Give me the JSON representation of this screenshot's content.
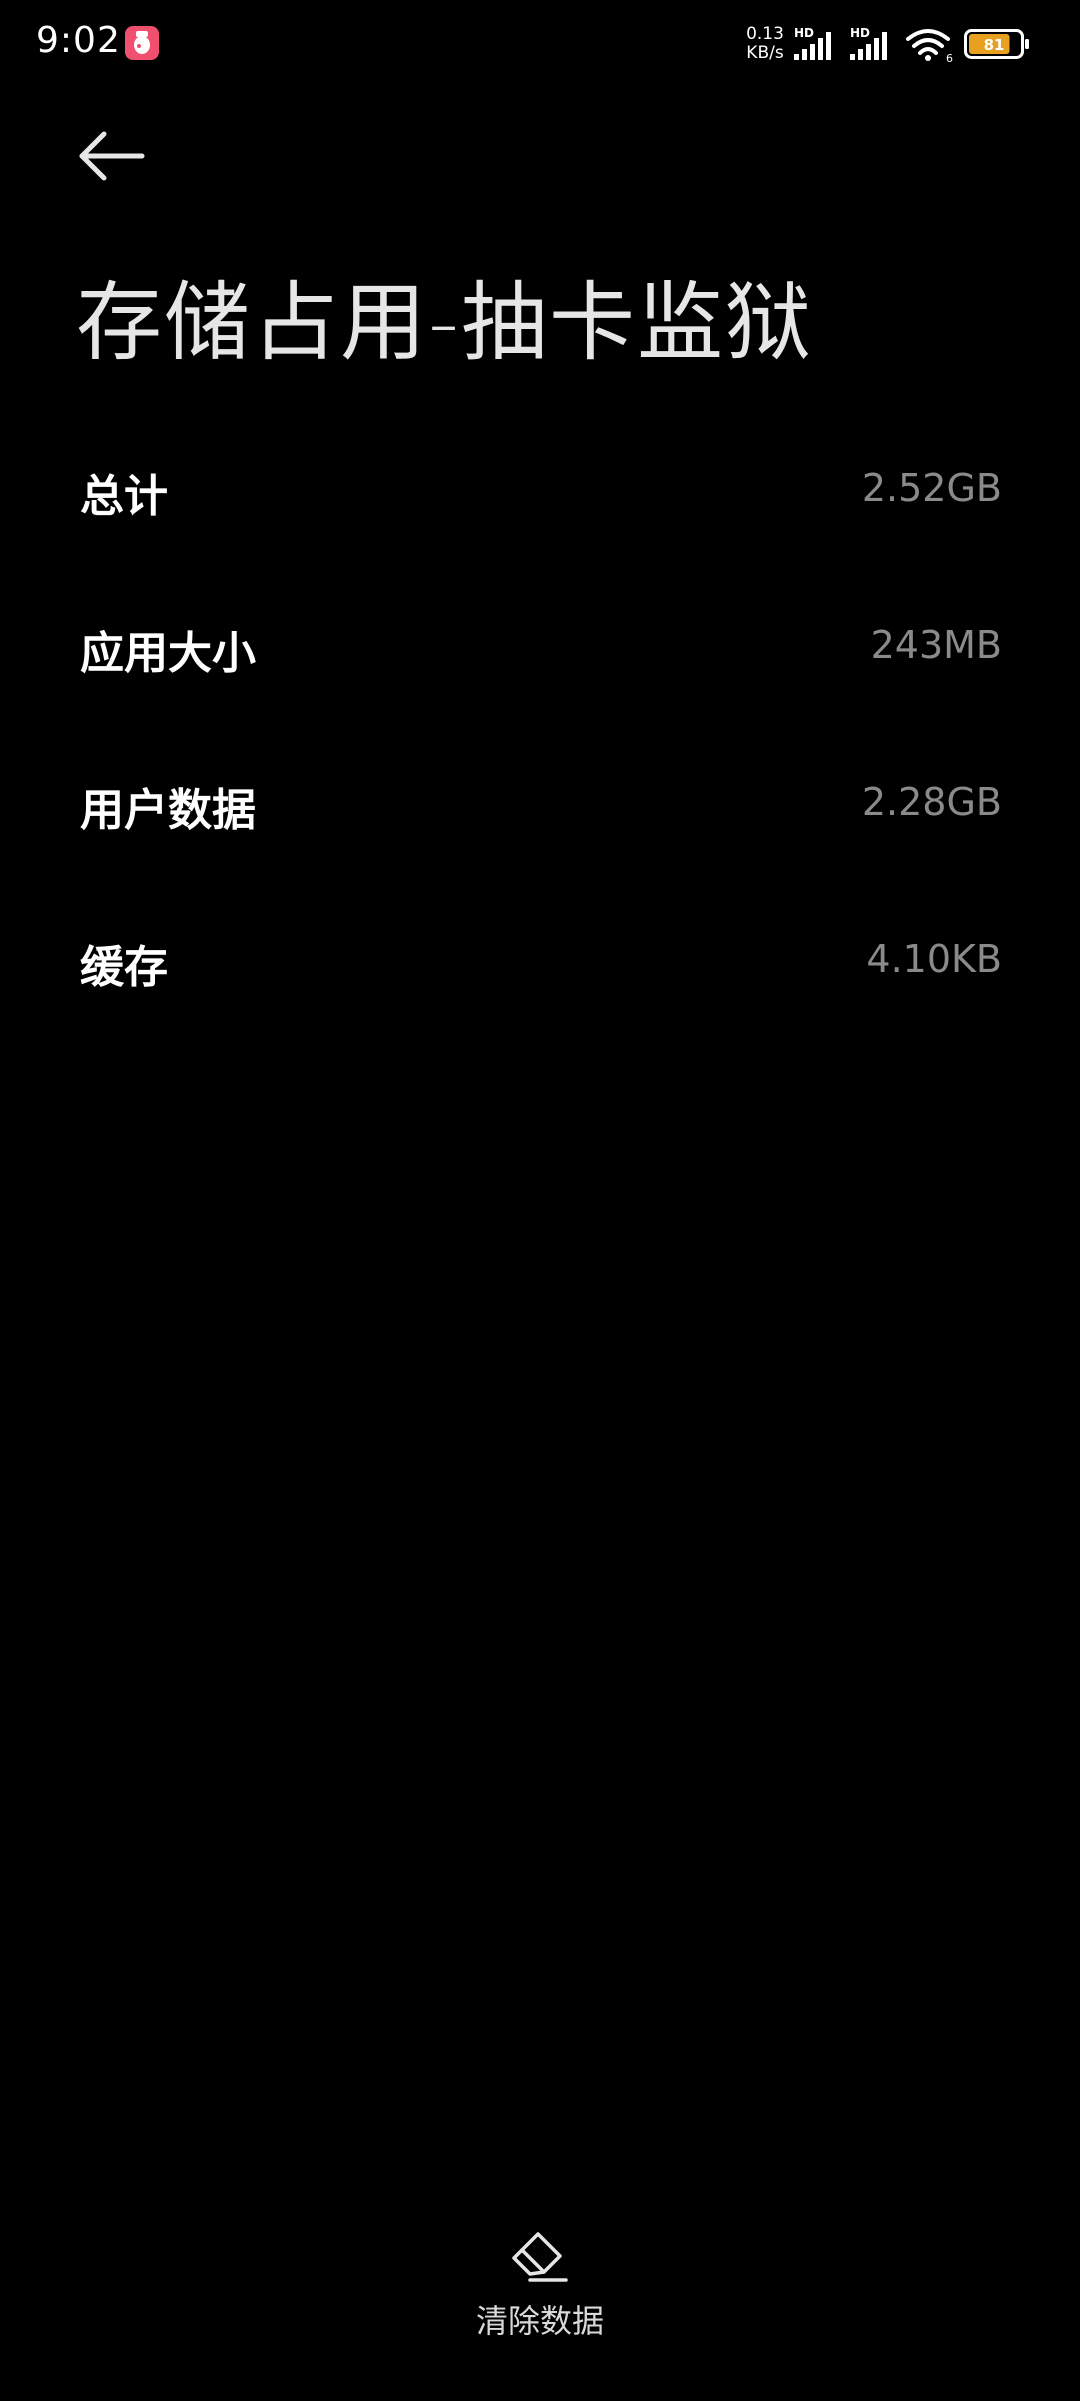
{
  "status_bar": {
    "time": "9:02",
    "net_speed_value": "0.13",
    "net_speed_unit": "KB/s",
    "signal_1_tag": "HD",
    "signal_2_tag": "HD",
    "wifi_tag": "6",
    "battery_level": "81",
    "battery_color": "#e8a020",
    "notif_icon_color": "#f0506e"
  },
  "header": {
    "back_icon": "arrow-left-icon",
    "title": "存储占用-抽卡监狱"
  },
  "storage": {
    "items": [
      {
        "label": "总计",
        "value": "2.52GB"
      },
      {
        "label": "应用大小",
        "value": "243MB"
      },
      {
        "label": "用户数据",
        "value": "2.28GB"
      },
      {
        "label": "缓存",
        "value": "4.10KB"
      }
    ]
  },
  "actions": {
    "clear_data_icon": "eraser-icon",
    "clear_data_label": "清除数据"
  }
}
